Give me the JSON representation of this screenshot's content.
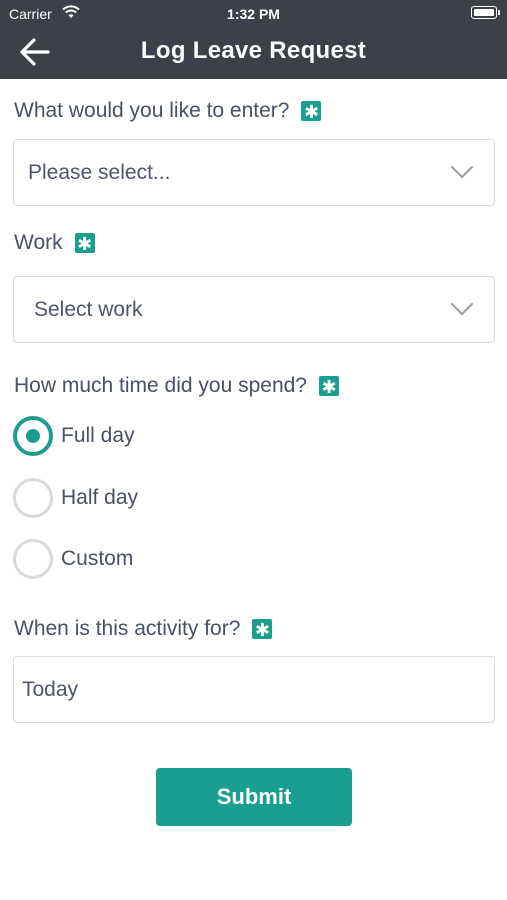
{
  "status_bar": {
    "carrier": "Carrier",
    "time": "1:32 PM"
  },
  "navbar": {
    "title": "Log Leave Request",
    "back_icon": "arrow-left-icon"
  },
  "form": {
    "entry_type": {
      "label": "What would you like to enter?",
      "required_mark": "✱",
      "value": "Please select..."
    },
    "work": {
      "label": "Work",
      "required_mark": "✱",
      "value": "Select work"
    },
    "time_spent": {
      "label": "How much time did you spend?",
      "required_mark": "✱",
      "options": [
        {
          "label": "Full day",
          "selected": true
        },
        {
          "label": "Half day",
          "selected": false
        },
        {
          "label": "Custom",
          "selected": false
        }
      ]
    },
    "activity_date": {
      "label": "When is this activity for?",
      "required_mark": "✱",
      "value": "Today"
    },
    "submit_label": "Submit"
  },
  "colors": {
    "accent": "#1a9e8f",
    "navbar_bg": "#3b4049"
  }
}
